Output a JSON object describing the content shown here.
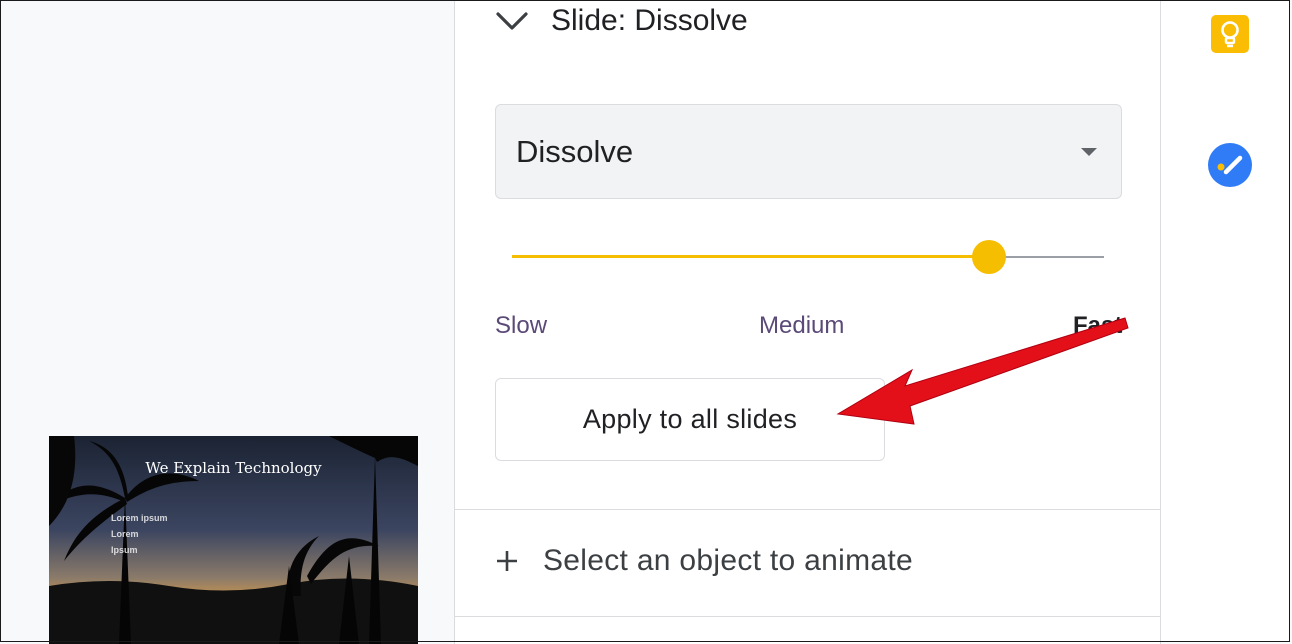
{
  "panel": {
    "section_title": "Slide: Dissolve",
    "transition_select": {
      "value": "Dissolve"
    },
    "speed_slider": {
      "value_fraction": 0.805,
      "color": "#f6be00"
    },
    "speed_labels": {
      "slow": "Slow",
      "medium": "Medium",
      "fast": "Fast"
    },
    "apply_button_label": "Apply to all slides",
    "animate_row_label": "Select an object to animate"
  },
  "thumbnail": {
    "title": "We Explain Technology",
    "bullets": [
      "Lorem ipsum",
      "Lorem",
      "Ipsum"
    ]
  },
  "side_panel": {
    "icons": [
      "keep-icon",
      "tasks-icon"
    ]
  },
  "annotation": {
    "arrow_color": "#e3101a"
  },
  "colors": {
    "accent": "#f6be00",
    "keep_yellow": "#fbbc04",
    "tasks_blue": "#2f7cf6"
  }
}
